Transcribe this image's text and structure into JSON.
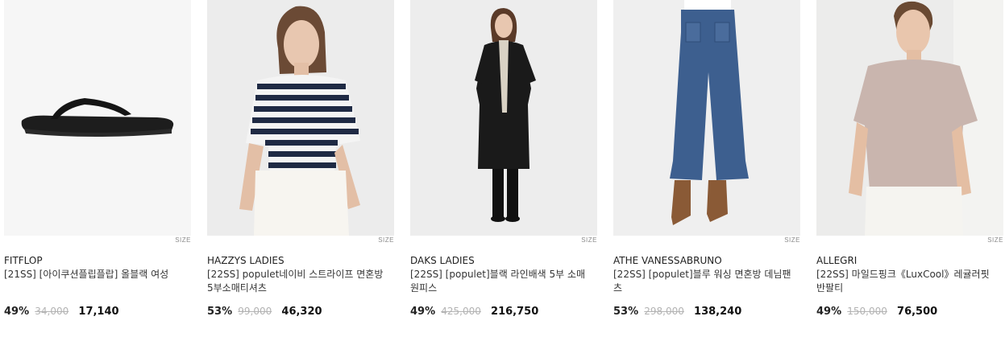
{
  "products": [
    {
      "brand": "FITFLOP",
      "name": "[21SS] [아이쿠션플립플랍] 올블랙 여성",
      "discount": "49%",
      "original_price": "34,000",
      "sale_price": "17,140",
      "size_tag": "SIZE"
    },
    {
      "brand": "HAZZYS LADIES",
      "name": "[22SS] populet네이비 스트라이프 면혼방 5부소매티셔츠",
      "discount": "53%",
      "original_price": "99,000",
      "sale_price": "46,320",
      "size_tag": "SIZE"
    },
    {
      "brand": "DAKS LADIES",
      "name": "[22SS] [populet]블랙 라인배색 5부 소매원피스",
      "discount": "49%",
      "original_price": "425,000",
      "sale_price": "216,750",
      "size_tag": "SIZE"
    },
    {
      "brand": "ATHE VANESSABRUNO",
      "name": "[22SS] [populet]블루 워싱 면혼방 데님팬츠",
      "discount": "53%",
      "original_price": "298,000",
      "sale_price": "138,240",
      "size_tag": "SIZE"
    },
    {
      "brand": "ALLEGRI",
      "name": "[22SS] 마일드핑크《LuxCool》레귤러핏 반팔티",
      "discount": "49%",
      "original_price": "150,000",
      "sale_price": "76,500",
      "size_tag": "SIZE"
    }
  ],
  "colors": {
    "text": "#222222",
    "strike": "#b3b3b3",
    "size_tag": "#8a8a8a"
  },
  "icons": [
    "sandal-image",
    "striped-tee-image",
    "black-dress-image",
    "denim-pants-image",
    "pink-tee-image"
  ]
}
